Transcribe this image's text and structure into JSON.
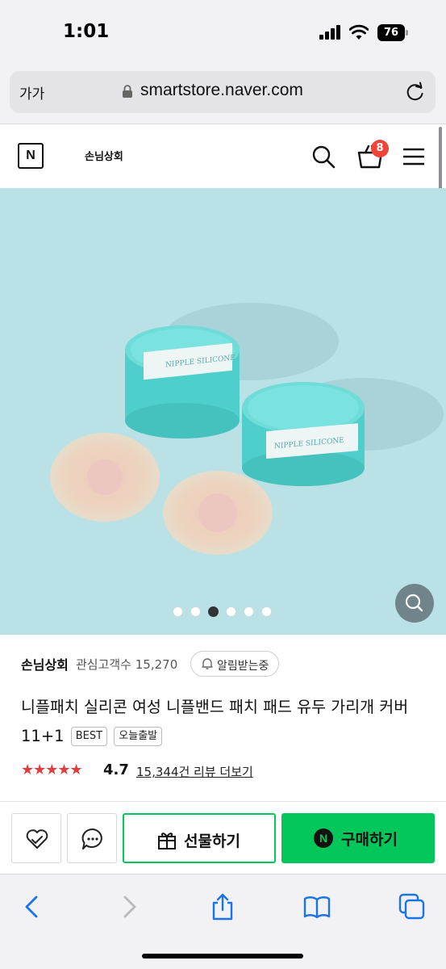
{
  "status": {
    "time": "1:01",
    "battery": "76"
  },
  "browser": {
    "text_size_label": "가가",
    "url": "smartstore.naver.com"
  },
  "store": {
    "logo_letter": "N",
    "name": "손님상회",
    "cart_count": "8"
  },
  "gallery": {
    "dot_count": 6,
    "active_index": 2
  },
  "product": {
    "seller": "손님상회",
    "interest_label": "관심고객수 15,270",
    "notify_label": "알림받는중",
    "title": "니플패치 실리콘 여성 니플밴드 패치 패드 유두 가리개 커버 11+1",
    "tags": [
      "BEST",
      "오늘출발"
    ],
    "stars": "★★★★★",
    "rating": "4.7",
    "reviews_label": "15,344건 리뷰 더보기"
  },
  "actions": {
    "gift_label": "선물하기",
    "buy_label": "구매하기",
    "buy_badge": "N"
  },
  "colors": {
    "naver_green": "#03c75a",
    "badge_red": "#f04438",
    "star_red": "#e23c3c",
    "hero_bg": "#b9e1e6"
  },
  "icons": [
    "signal-icon",
    "wifi-icon",
    "lock-icon",
    "reload-icon",
    "search-icon",
    "cart-icon",
    "menu-icon",
    "zoom-icon",
    "heart-icon",
    "chat-icon",
    "gift-icon",
    "back-icon",
    "forward-icon",
    "share-icon",
    "bookmarks-icon",
    "tabs-icon"
  ]
}
